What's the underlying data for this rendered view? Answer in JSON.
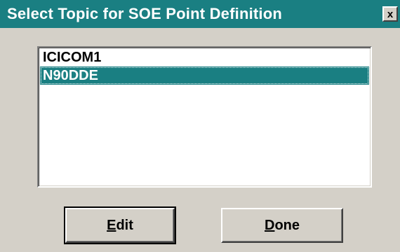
{
  "window": {
    "title": "Select Topic for SOE Point Definition",
    "close_glyph": "x"
  },
  "topics": {
    "items": [
      {
        "label": "ICICOM1",
        "selected": false
      },
      {
        "label": "N90DDE",
        "selected": true
      }
    ],
    "selected_index": 1
  },
  "buttons": {
    "edit": {
      "mnemonic": "E",
      "rest": "dit"
    },
    "done": {
      "mnemonic": "D",
      "rest": "one"
    }
  },
  "colors": {
    "titlebar": "#1a7f82",
    "selection": "#1a7f82",
    "face": "#d4d0c8"
  },
  "icons": {
    "close": "close-icon"
  }
}
